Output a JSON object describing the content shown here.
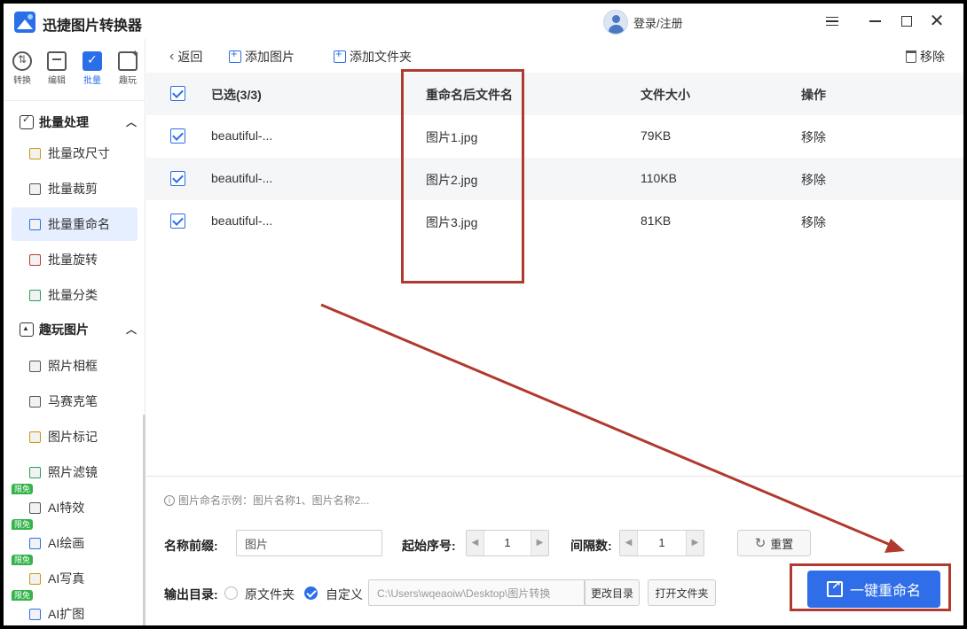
{
  "app": {
    "title": "迅捷图片转换器",
    "login_label": "登录/注册"
  },
  "top_tabs": [
    {
      "label": "转换"
    },
    {
      "label": "编辑"
    },
    {
      "label": "批量"
    },
    {
      "label": "趣玩"
    }
  ],
  "nav": {
    "group_batch": "批量处理",
    "group_fun": "趣玩图片",
    "items": [
      {
        "label": "批量改尺寸"
      },
      {
        "label": "批量裁剪"
      },
      {
        "label": "批量重命名"
      },
      {
        "label": "批量旋转"
      },
      {
        "label": "批量分类"
      },
      {
        "label": "照片相框"
      },
      {
        "label": "马赛克笔"
      },
      {
        "label": "图片标记"
      },
      {
        "label": "照片滤镜"
      },
      {
        "label": "AI特效",
        "badge": "限免"
      },
      {
        "label": "AI绘画",
        "badge": "限免"
      },
      {
        "label": "AI写真",
        "badge": "限免"
      },
      {
        "label": "AI扩图",
        "badge": "限免"
      }
    ]
  },
  "toolbar": {
    "back": "返回",
    "add_image": "添加图片",
    "add_folder": "添加文件夹",
    "remove": "移除"
  },
  "table": {
    "headers": {
      "selected": "已选(3/3)",
      "rename": "重命名后文件名",
      "size": "文件大小",
      "action": "操作"
    },
    "rows": [
      {
        "name": "beautiful-...",
        "rename": "图片1.jpg",
        "size": "79KB",
        "action": "移除"
      },
      {
        "name": "beautiful-...",
        "rename": "图片2.jpg",
        "size": "110KB",
        "action": "移除"
      },
      {
        "name": "beautiful-...",
        "rename": "图片3.jpg",
        "size": "81KB",
        "action": "移除"
      }
    ]
  },
  "settings": {
    "hint": "图片命名示例：图片名称1、图片名称2...",
    "prefix_label": "名称前缀:",
    "prefix_value": "图片",
    "start_label": "起始序号:",
    "start_value": "1",
    "interval_label": "间隔数:",
    "interval_value": "1",
    "reset_label": "重置",
    "output_label": "输出目录:",
    "option_original": "原文件夹",
    "option_custom": "自定义",
    "path_value": "C:\\Users\\wqeaoiw\\Desktop\\图片转换",
    "change_dir": "更改目录",
    "open_folder": "打开文件夹",
    "primary_action": "一键重命名"
  },
  "colors": {
    "accent": "#2f6ee8",
    "annotation": "#b03a2e"
  }
}
